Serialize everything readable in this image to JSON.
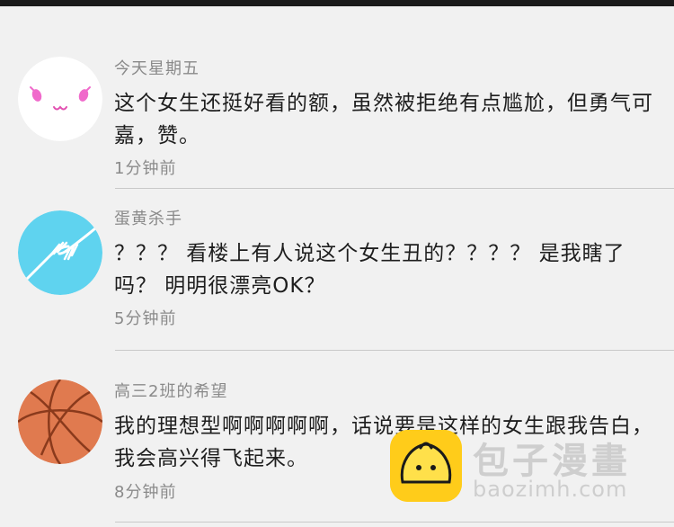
{
  "comments": [
    {
      "username": "今天星期五",
      "content": "这个女生还挺好看的额，虽然被拒绝有点尴尬，但勇气可嘉，赞。",
      "time": "1分钟前",
      "avatar_icon": "kawaii-face-icon"
    },
    {
      "username": "蛋黄杀手",
      "content": "？？？ 看楼上有人说这个女生丑的？？？？ 是我瞎了吗？ 明明很漂亮OK？",
      "time": "5分钟前",
      "avatar_icon": "reaching-hands-icon"
    },
    {
      "username": "高三2班的希望",
      "content": "我的理想型啊啊啊啊啊，话说要是这样的女生跟我告白，我会高兴得飞起来。",
      "time": "8分钟前",
      "avatar_icon": "basketball-icon"
    }
  ],
  "watermark": {
    "brand": "包子漫畫",
    "url": "baozimh.com",
    "logo_icon": "baozi-bun-icon"
  },
  "colors": {
    "background": "#f1f1f1",
    "text_primary": "#1e1e1e",
    "text_secondary": "#8a8a8a",
    "divider": "#c9c9c9",
    "avatar2_bg": "#5fd3ef",
    "avatar3_bg": "#e07a4f",
    "watermark_logo": "#ffcc1a"
  }
}
